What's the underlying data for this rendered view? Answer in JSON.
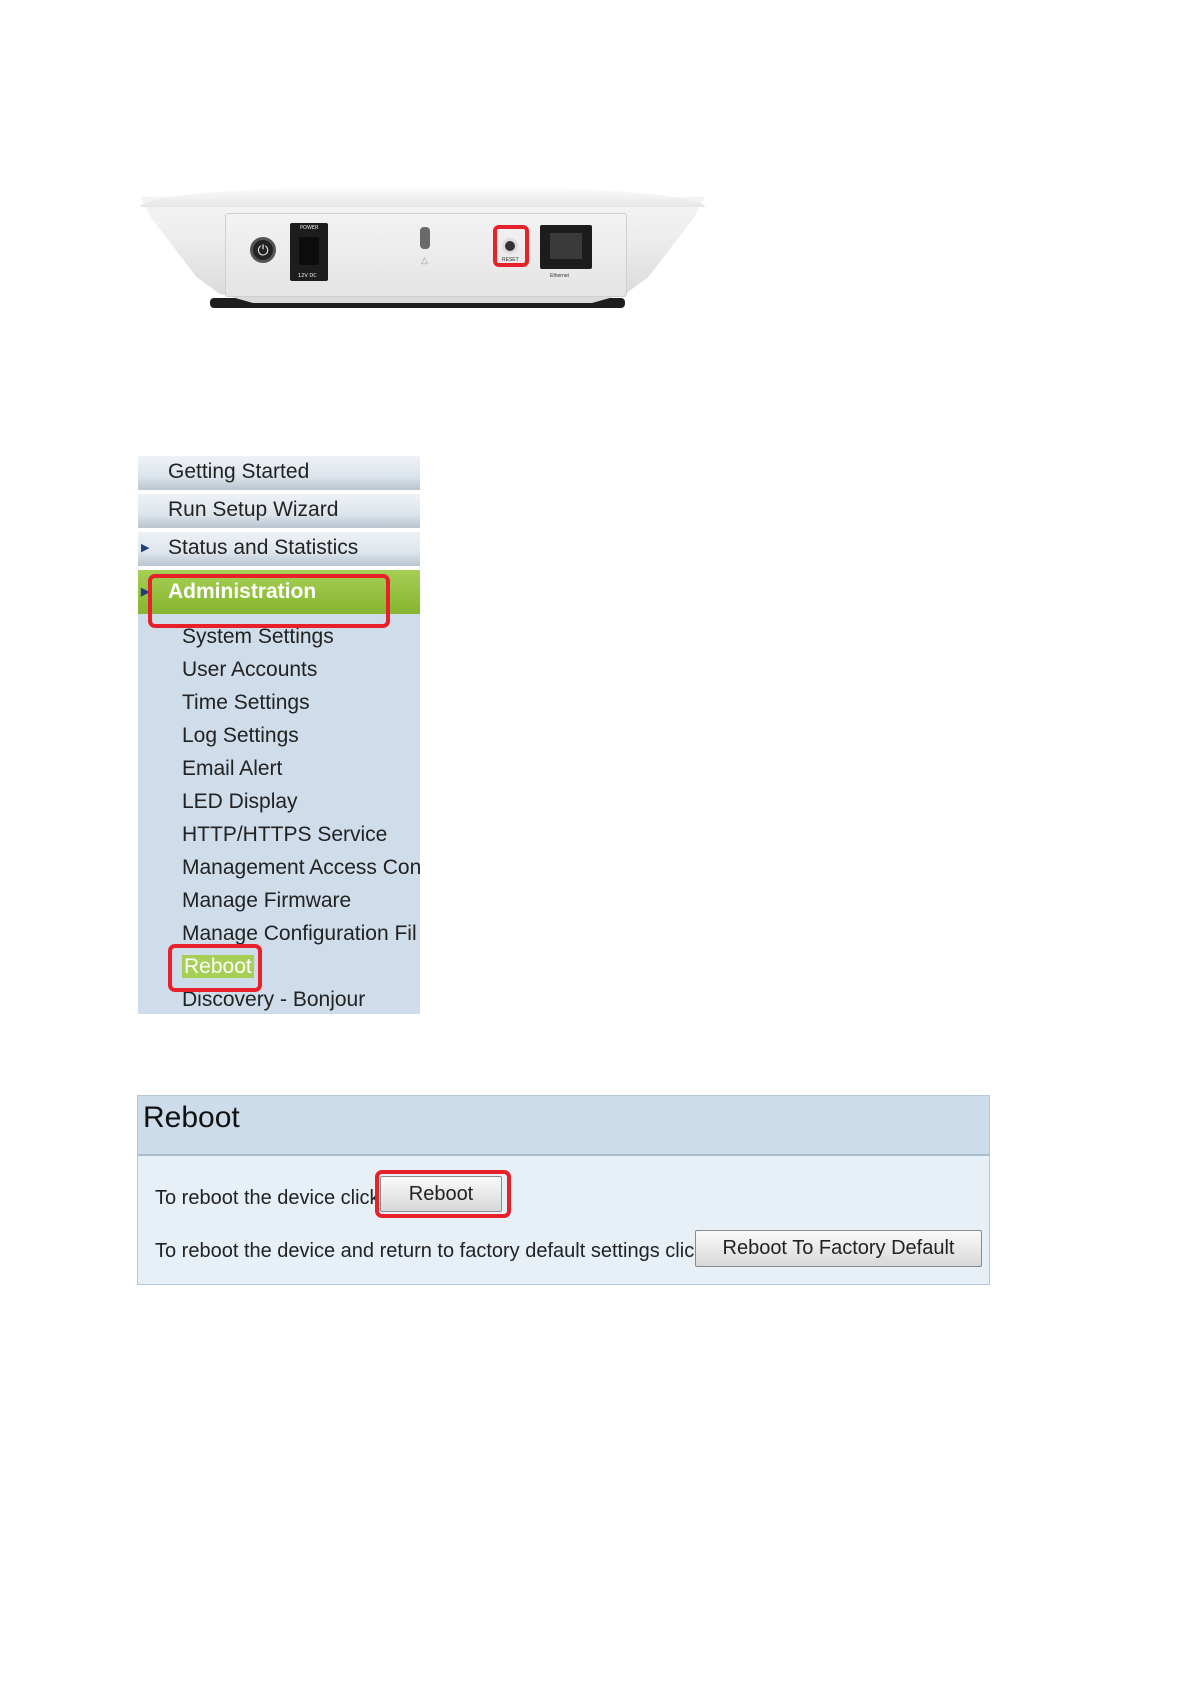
{
  "device": {
    "power_label": "POWER",
    "voltage_label": "12V DC",
    "reset_label": "RESET",
    "ethernet_label": "Ethernet"
  },
  "nav": {
    "top_items": [
      "Getting Started",
      "Run Setup Wizard",
      "Status and Statistics"
    ],
    "section": "Administration",
    "sub_items": [
      "System Settings",
      "User Accounts",
      "Time Settings",
      "Log Settings",
      "Email Alert",
      "LED Display",
      "HTTP/HTTPS Service",
      "Management Access Con",
      "Manage Firmware",
      "Manage Configuration Fil",
      "Reboot",
      "Discovery - Bonjour"
    ],
    "active_item": "Reboot"
  },
  "panel": {
    "title": "Reboot",
    "row1_text": "To reboot the device click",
    "reboot_button": "Reboot",
    "row2_text": "To reboot the device and return to factory default settings click",
    "factory_button": "Reboot To Factory Default"
  },
  "highlight_color": "#e8202a",
  "accent_green": "#a6cf55"
}
